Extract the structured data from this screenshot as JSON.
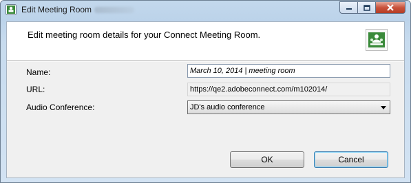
{
  "window": {
    "title": "Edit Meeting Room"
  },
  "header": {
    "text": "Edit meeting room details for your Connect Meeting Room."
  },
  "form": {
    "name_label": "Name:",
    "name_value": "March 10, 2014 | meeting room",
    "url_label": "URL:",
    "url_value": "https://qe2.adobeconnect.com/m102014/",
    "audio_label": "Audio Conference:",
    "audio_value": "JD's audio conference"
  },
  "buttons": {
    "ok_label": "OK",
    "cancel_label": "Cancel"
  },
  "icons": {
    "app": "connect-app-icon",
    "header": "meeting-room-icon",
    "minimize": "minimize-icon",
    "maximize": "maximize-icon",
    "close": "close-icon",
    "dropdown": "chevron-down-icon"
  },
  "colors": {
    "accent": "#3c7fb1",
    "close_button": "#c9523b",
    "brand_green": "#3a8a3a"
  }
}
